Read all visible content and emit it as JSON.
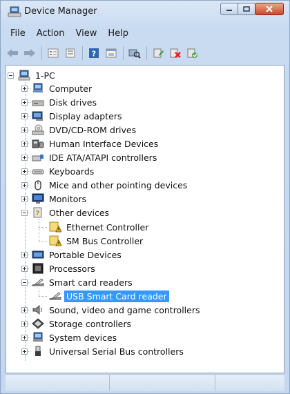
{
  "window": {
    "title": "Device Manager"
  },
  "menu": [
    "File",
    "Action",
    "View",
    "Help"
  ],
  "toolbar_icons": [
    "back-arrow-icon",
    "forward-arrow-icon",
    "properties-view-icon",
    "devices-view-icon",
    "help-icon",
    "resources-view-icon",
    "scan-hardware-icon",
    "update-driver-icon",
    "uninstall-icon",
    "disable-device-icon"
  ],
  "tree": {
    "root": "1-PC",
    "items": [
      {
        "label": "Computer",
        "icon": "computer-icon"
      },
      {
        "label": "Disk drives",
        "icon": "disk-drive-icon"
      },
      {
        "label": "Display adapters",
        "icon": "display-adapter-icon"
      },
      {
        "label": "DVD/CD-ROM drives",
        "icon": "dvd-drive-icon"
      },
      {
        "label": "Human Interface Devices",
        "icon": "hid-icon"
      },
      {
        "label": "IDE ATA/ATAPI controllers",
        "icon": "ide-controller-icon"
      },
      {
        "label": "Keyboards",
        "icon": "keyboard-icon"
      },
      {
        "label": "Mice and other pointing devices",
        "icon": "mouse-icon"
      },
      {
        "label": "Monitors",
        "icon": "monitor-icon"
      },
      {
        "label": "Other devices",
        "icon": "unknown-device-icon",
        "children": [
          {
            "label": "Ethernet Controller",
            "icon": "warning-device-icon"
          },
          {
            "label": "SM Bus Controller",
            "icon": "warning-device-icon"
          }
        ]
      },
      {
        "label": "Portable Devices",
        "icon": "portable-device-icon"
      },
      {
        "label": "Processors",
        "icon": "processor-icon"
      },
      {
        "label": "Smart card readers",
        "icon": "smart-card-reader-icon",
        "children": [
          {
            "label": "USB Smart Card reader",
            "icon": "smart-card-reader-icon",
            "selected": true
          }
        ]
      },
      {
        "label": "Sound, video and game controllers",
        "icon": "sound-icon"
      },
      {
        "label": "Storage controllers",
        "icon": "storage-controller-icon"
      },
      {
        "label": "System devices",
        "icon": "system-device-icon"
      },
      {
        "label": "Universal Serial Bus controllers",
        "icon": "usb-icon"
      }
    ]
  },
  "colors": {
    "selection": "#3399ff",
    "close_button": "#c8482b",
    "frame": "#c9dbf1"
  }
}
